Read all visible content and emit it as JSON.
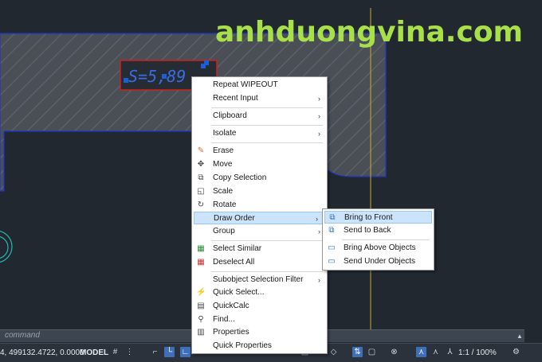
{
  "watermark": "anhduongvina.com",
  "dimension_text": "S=5,89",
  "command_line": {
    "placeholder": "command"
  },
  "status_bar": {
    "coordinates": "4, 499132.4722, 0.0000",
    "model_label": "MODEL",
    "annotation_scale": "1:1 / 100%"
  },
  "context_menu": {
    "items": [
      {
        "label": "Repeat WIPEOUT",
        "icon": "",
        "submenu": false
      },
      {
        "label": "Recent Input",
        "icon": "",
        "submenu": true
      },
      {
        "label": "Clipboard",
        "icon": "",
        "submenu": true
      },
      {
        "label": "Isolate",
        "icon": "",
        "submenu": true
      },
      {
        "label": "Erase",
        "icon": "eraser-icon",
        "submenu": false
      },
      {
        "label": "Move",
        "icon": "move-icon",
        "submenu": false
      },
      {
        "label": "Copy Selection",
        "icon": "copy-icon",
        "submenu": false
      },
      {
        "label": "Scale",
        "icon": "scale-icon",
        "submenu": false
      },
      {
        "label": "Rotate",
        "icon": "rotate-icon",
        "submenu": false
      },
      {
        "label": "Draw Order",
        "icon": "",
        "submenu": true,
        "highlighted": true
      },
      {
        "label": "Group",
        "icon": "",
        "submenu": true
      },
      {
        "label": "Select Similar",
        "icon": "select-similar-icon",
        "submenu": false
      },
      {
        "label": "Deselect All",
        "icon": "deselect-icon",
        "submenu": false
      },
      {
        "label": "Subobject Selection Filter",
        "icon": "",
        "submenu": true
      },
      {
        "label": "Quick Select...",
        "icon": "quick-select-icon",
        "submenu": false
      },
      {
        "label": "QuickCalc",
        "icon": "calculator-icon",
        "submenu": false
      },
      {
        "label": "Find...",
        "icon": "find-icon",
        "submenu": false
      },
      {
        "label": "Properties",
        "icon": "properties-icon",
        "submenu": false
      },
      {
        "label": "Quick Properties",
        "icon": "",
        "submenu": false
      }
    ]
  },
  "draw_order_submenu": {
    "items": [
      {
        "label": "Bring to Front",
        "icon": "bring-to-front-icon",
        "highlighted": true
      },
      {
        "label": "Send to Back",
        "icon": "send-to-back-icon"
      },
      {
        "label": "Bring Above Objects",
        "icon": "bring-above-icon"
      },
      {
        "label": "Send Under Objects",
        "icon": "send-under-icon"
      }
    ]
  },
  "colors": {
    "canvas_bg": "#212830",
    "watermark": "#a8e04a",
    "highlight": "#cce4fb",
    "selection_blue": "#1a5fd6",
    "guide_line": "#c8a838"
  }
}
